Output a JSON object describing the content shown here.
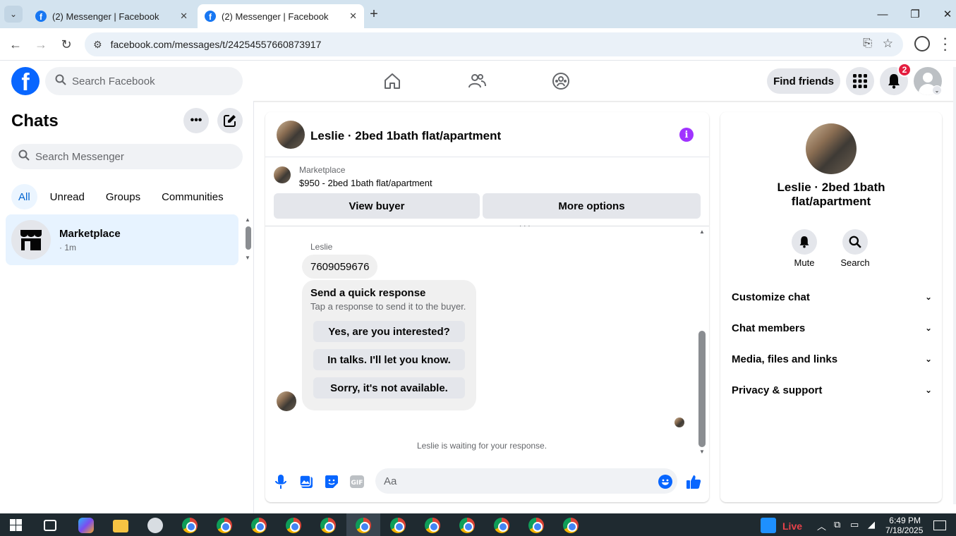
{
  "browser": {
    "tabs": [
      {
        "title": "(2) Messenger | Facebook",
        "active": false
      },
      {
        "title": "(2) Messenger | Facebook",
        "active": true
      }
    ],
    "url": "facebook.com/messages/t/24254557660873917"
  },
  "fb_header": {
    "search_placeholder": "Search Facebook",
    "find_friends_label": "Find friends",
    "notification_count": "2"
  },
  "chats": {
    "title": "Chats",
    "search_placeholder": "Search Messenger",
    "filters": [
      "All",
      "Unread",
      "Groups",
      "Communities"
    ],
    "active_filter": "All",
    "items": [
      {
        "name": "Marketplace",
        "time": "· 1m"
      }
    ]
  },
  "conversation": {
    "title": "Leslie · 2bed 1bath flat/apartment",
    "marketplace_label": "Marketplace",
    "listing": "$950 - 2bed 1bath flat/apartment",
    "view_buyer_label": "View buyer",
    "more_options_label": "More options",
    "sender_name": "Leslie",
    "phone_message": "7609059676",
    "quick_response_title": "Send a quick response",
    "quick_response_subtitle": "Tap a response to send it to the buyer.",
    "quick_responses": [
      "Yes, are you interested?",
      "In talks. I'll let you know.",
      "Sorry, it's not available."
    ],
    "waiting_text": "Leslie is waiting for your response.",
    "composer_placeholder": "Aa"
  },
  "info_panel": {
    "name": "Leslie · 2bed 1bath flat/apartment",
    "mute_label": "Mute",
    "search_label": "Search",
    "sections": [
      "Customize chat",
      "Chat members",
      "Media, files and links",
      "Privacy & support"
    ]
  },
  "taskbar": {
    "live_label": "Live",
    "time": "6:49 PM",
    "date": "7/18/2025"
  },
  "colors": {
    "facebook_blue": "#0866ff",
    "messenger_purple": "#a033ff",
    "badge_red": "#e41e3f"
  }
}
